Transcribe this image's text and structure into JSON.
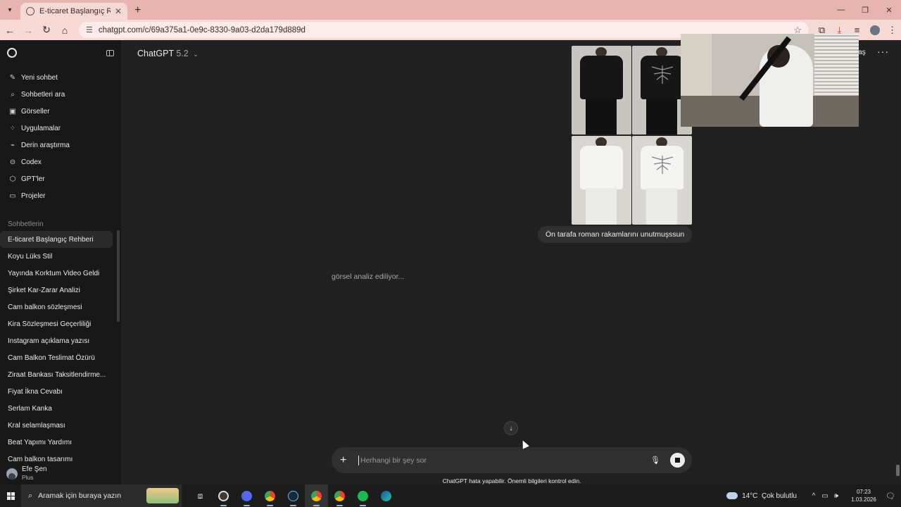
{
  "browser": {
    "tab_title": "E-ticaret Başlangıç Rehberi",
    "url": "chatgpt.com/c/69a375a1-0e9c-8330-9a03-d2da179d889d"
  },
  "app": {
    "model_name": "ChatGPT",
    "model_version": "5.2",
    "share_label": "laş",
    "composer_placeholder": "Herhangi bir şey sor",
    "disclaimer": "ChatGPT hata yapabilir. Önemli bilgileri kontrol edin.",
    "status_text": "görsel analiz ediliyor...",
    "user_message_caption": "Ön tarafa roman rakamlarını unutmuşssun"
  },
  "sidebar": {
    "menu": [
      {
        "label": "Yeni sohbet",
        "icon": "edit-icon"
      },
      {
        "label": "Sohbetleri ara",
        "icon": "search-icon"
      },
      {
        "label": "Görseller",
        "icon": "image-icon"
      },
      {
        "label": "Uygulamalar",
        "icon": "apps-icon"
      },
      {
        "label": "Derin araştırma",
        "icon": "research-icon"
      },
      {
        "label": "Codex",
        "icon": "codex-icon"
      },
      {
        "label": "GPT'ler",
        "icon": "cube-icon"
      },
      {
        "label": "Projeler",
        "icon": "folder-icon"
      }
    ],
    "section_title": "Sohbetlerin",
    "chats": [
      "E-ticaret Başlangıç Rehberi",
      "Koyu Lüks Stil",
      "Yayında Korktum Video Geldi",
      "Şirket Kar-Zarar Analizi",
      "Cam balkon sözleşmesi",
      "Kira Sözleşmesi Geçerliliği",
      "Instagram açıklama yazısı",
      "Cam Balkon Teslimat Özürü",
      "Ziraat Bankası Taksitlendirme...",
      "Fiyat İkna Cevabı",
      "Serlam Kanka",
      "Kral selamlaşması",
      "Beat Yapımı Yardımı",
      "Cam balkon tasarımı"
    ],
    "user": {
      "name": "Efe Şen",
      "plan": "Plus"
    }
  },
  "taskbar": {
    "search_placeholder": "Aramak için buraya yazın",
    "weather_temp": "14°C",
    "weather_desc": "Çok bulutlu",
    "time": "07:23",
    "date": "1.03.2026"
  },
  "colors": {
    "accent_tab": "#e8b4b0",
    "app_bg": "#212121",
    "sidebar_bg": "#181818",
    "taskbar_bg": "#1c1c1c"
  }
}
